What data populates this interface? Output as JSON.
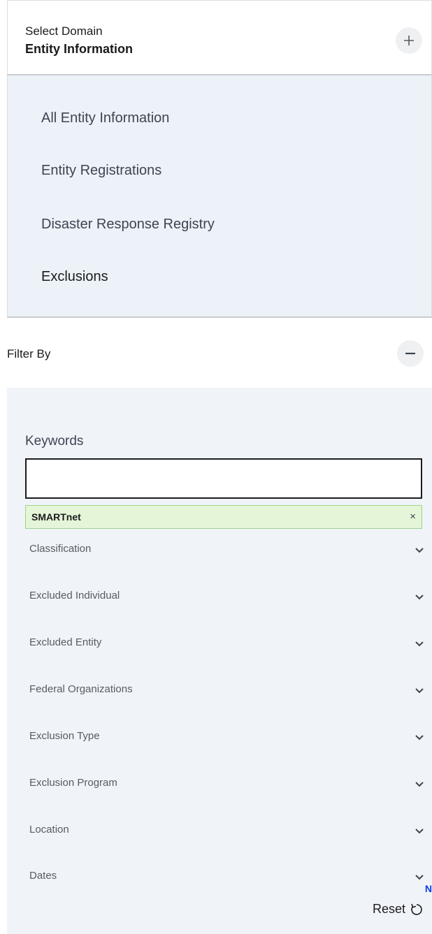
{
  "domain_header": {
    "label": "Select Domain",
    "value": "Entity Information",
    "toggle_icon": "plus-icon"
  },
  "domain_list": {
    "items": [
      {
        "label": "All Entity Information"
      },
      {
        "label": "Entity Registrations"
      },
      {
        "label": "Disaster Response Registry"
      },
      {
        "label": "Exclusions",
        "active": true
      }
    ]
  },
  "filter": {
    "title": "Filter By",
    "toggle_icon": "minus-icon",
    "keywords_label": "Keywords",
    "keywords_value": "",
    "chip_label": "SMARTnet",
    "chip_remove": "×",
    "sections": [
      {
        "label": "Classification"
      },
      {
        "label": "Excluded Individual"
      },
      {
        "label": "Excluded Entity"
      },
      {
        "label": "Federal Organizations"
      },
      {
        "label": "Exclusion Type"
      },
      {
        "label": "Exclusion Program"
      },
      {
        "label": "Location"
      },
      {
        "label": "Dates"
      }
    ],
    "reset_label": "Reset",
    "reset_icon": "refresh-icon"
  },
  "corner_mark": "N",
  "colors": {
    "list_bg": "#edf2f8",
    "filter_bg": "#f0f4f9",
    "chip_bg": "#e4f5d8",
    "chip_border": "#9fd38a"
  }
}
